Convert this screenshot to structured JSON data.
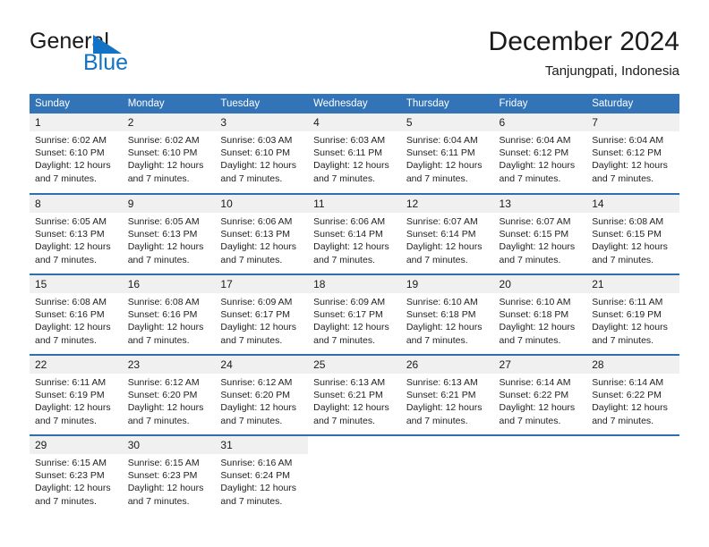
{
  "brand": {
    "word_general": "General",
    "word_blue": "Blue",
    "flag_icon": "triangle-flag-icon",
    "blue_hex": "#1273c4"
  },
  "header": {
    "month_title": "December 2024",
    "location": "Tanjungpati, Indonesia"
  },
  "colors": {
    "header_blue": "#3274b7",
    "row_divider_blue": "#2f6fb0",
    "daynum_band": "#f0f0f0",
    "text": "#1a1a1a"
  },
  "weekdays": [
    "Sunday",
    "Monday",
    "Tuesday",
    "Wednesday",
    "Thursday",
    "Friday",
    "Saturday"
  ],
  "weeks": [
    [
      {
        "day": "1",
        "sunrise": "Sunrise: 6:02 AM",
        "sunset": "Sunset: 6:10 PM",
        "daylight1": "Daylight: 12 hours",
        "daylight2": "and 7 minutes."
      },
      {
        "day": "2",
        "sunrise": "Sunrise: 6:02 AM",
        "sunset": "Sunset: 6:10 PM",
        "daylight1": "Daylight: 12 hours",
        "daylight2": "and 7 minutes."
      },
      {
        "day": "3",
        "sunrise": "Sunrise: 6:03 AM",
        "sunset": "Sunset: 6:10 PM",
        "daylight1": "Daylight: 12 hours",
        "daylight2": "and 7 minutes."
      },
      {
        "day": "4",
        "sunrise": "Sunrise: 6:03 AM",
        "sunset": "Sunset: 6:11 PM",
        "daylight1": "Daylight: 12 hours",
        "daylight2": "and 7 minutes."
      },
      {
        "day": "5",
        "sunrise": "Sunrise: 6:04 AM",
        "sunset": "Sunset: 6:11 PM",
        "daylight1": "Daylight: 12 hours",
        "daylight2": "and 7 minutes."
      },
      {
        "day": "6",
        "sunrise": "Sunrise: 6:04 AM",
        "sunset": "Sunset: 6:12 PM",
        "daylight1": "Daylight: 12 hours",
        "daylight2": "and 7 minutes."
      },
      {
        "day": "7",
        "sunrise": "Sunrise: 6:04 AM",
        "sunset": "Sunset: 6:12 PM",
        "daylight1": "Daylight: 12 hours",
        "daylight2": "and 7 minutes."
      }
    ],
    [
      {
        "day": "8",
        "sunrise": "Sunrise: 6:05 AM",
        "sunset": "Sunset: 6:13 PM",
        "daylight1": "Daylight: 12 hours",
        "daylight2": "and 7 minutes."
      },
      {
        "day": "9",
        "sunrise": "Sunrise: 6:05 AM",
        "sunset": "Sunset: 6:13 PM",
        "daylight1": "Daylight: 12 hours",
        "daylight2": "and 7 minutes."
      },
      {
        "day": "10",
        "sunrise": "Sunrise: 6:06 AM",
        "sunset": "Sunset: 6:13 PM",
        "daylight1": "Daylight: 12 hours",
        "daylight2": "and 7 minutes."
      },
      {
        "day": "11",
        "sunrise": "Sunrise: 6:06 AM",
        "sunset": "Sunset: 6:14 PM",
        "daylight1": "Daylight: 12 hours",
        "daylight2": "and 7 minutes."
      },
      {
        "day": "12",
        "sunrise": "Sunrise: 6:07 AM",
        "sunset": "Sunset: 6:14 PM",
        "daylight1": "Daylight: 12 hours",
        "daylight2": "and 7 minutes."
      },
      {
        "day": "13",
        "sunrise": "Sunrise: 6:07 AM",
        "sunset": "Sunset: 6:15 PM",
        "daylight1": "Daylight: 12 hours",
        "daylight2": "and 7 minutes."
      },
      {
        "day": "14",
        "sunrise": "Sunrise: 6:08 AM",
        "sunset": "Sunset: 6:15 PM",
        "daylight1": "Daylight: 12 hours",
        "daylight2": "and 7 minutes."
      }
    ],
    [
      {
        "day": "15",
        "sunrise": "Sunrise: 6:08 AM",
        "sunset": "Sunset: 6:16 PM",
        "daylight1": "Daylight: 12 hours",
        "daylight2": "and 7 minutes."
      },
      {
        "day": "16",
        "sunrise": "Sunrise: 6:08 AM",
        "sunset": "Sunset: 6:16 PM",
        "daylight1": "Daylight: 12 hours",
        "daylight2": "and 7 minutes."
      },
      {
        "day": "17",
        "sunrise": "Sunrise: 6:09 AM",
        "sunset": "Sunset: 6:17 PM",
        "daylight1": "Daylight: 12 hours",
        "daylight2": "and 7 minutes."
      },
      {
        "day": "18",
        "sunrise": "Sunrise: 6:09 AM",
        "sunset": "Sunset: 6:17 PM",
        "daylight1": "Daylight: 12 hours",
        "daylight2": "and 7 minutes."
      },
      {
        "day": "19",
        "sunrise": "Sunrise: 6:10 AM",
        "sunset": "Sunset: 6:18 PM",
        "daylight1": "Daylight: 12 hours",
        "daylight2": "and 7 minutes."
      },
      {
        "day": "20",
        "sunrise": "Sunrise: 6:10 AM",
        "sunset": "Sunset: 6:18 PM",
        "daylight1": "Daylight: 12 hours",
        "daylight2": "and 7 minutes."
      },
      {
        "day": "21",
        "sunrise": "Sunrise: 6:11 AM",
        "sunset": "Sunset: 6:19 PM",
        "daylight1": "Daylight: 12 hours",
        "daylight2": "and 7 minutes."
      }
    ],
    [
      {
        "day": "22",
        "sunrise": "Sunrise: 6:11 AM",
        "sunset": "Sunset: 6:19 PM",
        "daylight1": "Daylight: 12 hours",
        "daylight2": "and 7 minutes."
      },
      {
        "day": "23",
        "sunrise": "Sunrise: 6:12 AM",
        "sunset": "Sunset: 6:20 PM",
        "daylight1": "Daylight: 12 hours",
        "daylight2": "and 7 minutes."
      },
      {
        "day": "24",
        "sunrise": "Sunrise: 6:12 AM",
        "sunset": "Sunset: 6:20 PM",
        "daylight1": "Daylight: 12 hours",
        "daylight2": "and 7 minutes."
      },
      {
        "day": "25",
        "sunrise": "Sunrise: 6:13 AM",
        "sunset": "Sunset: 6:21 PM",
        "daylight1": "Daylight: 12 hours",
        "daylight2": "and 7 minutes."
      },
      {
        "day": "26",
        "sunrise": "Sunrise: 6:13 AM",
        "sunset": "Sunset: 6:21 PM",
        "daylight1": "Daylight: 12 hours",
        "daylight2": "and 7 minutes."
      },
      {
        "day": "27",
        "sunrise": "Sunrise: 6:14 AM",
        "sunset": "Sunset: 6:22 PM",
        "daylight1": "Daylight: 12 hours",
        "daylight2": "and 7 minutes."
      },
      {
        "day": "28",
        "sunrise": "Sunrise: 6:14 AM",
        "sunset": "Sunset: 6:22 PM",
        "daylight1": "Daylight: 12 hours",
        "daylight2": "and 7 minutes."
      }
    ],
    [
      {
        "day": "29",
        "sunrise": "Sunrise: 6:15 AM",
        "sunset": "Sunset: 6:23 PM",
        "daylight1": "Daylight: 12 hours",
        "daylight2": "and 7 minutes."
      },
      {
        "day": "30",
        "sunrise": "Sunrise: 6:15 AM",
        "sunset": "Sunset: 6:23 PM",
        "daylight1": "Daylight: 12 hours",
        "daylight2": "and 7 minutes."
      },
      {
        "day": "31",
        "sunrise": "Sunrise: 6:16 AM",
        "sunset": "Sunset: 6:24 PM",
        "daylight1": "Daylight: 12 hours",
        "daylight2": "and 7 minutes."
      },
      {
        "day": "",
        "sunrise": "",
        "sunset": "",
        "daylight1": "",
        "daylight2": ""
      },
      {
        "day": "",
        "sunrise": "",
        "sunset": "",
        "daylight1": "",
        "daylight2": ""
      },
      {
        "day": "",
        "sunrise": "",
        "sunset": "",
        "daylight1": "",
        "daylight2": ""
      },
      {
        "day": "",
        "sunrise": "",
        "sunset": "",
        "daylight1": "",
        "daylight2": ""
      }
    ]
  ]
}
